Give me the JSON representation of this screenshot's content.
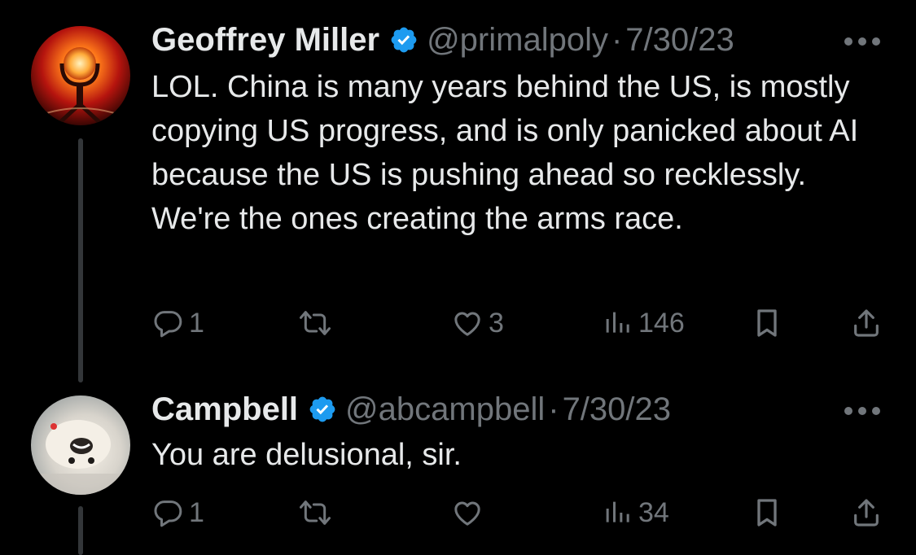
{
  "tweets": [
    {
      "author": {
        "name": "Geoffrey Miller",
        "handle": "@primalpoly",
        "verified": true
      },
      "date": "7/30/23",
      "separator": "·",
      "text": "LOL. China is many years behind the US, is mostly copying US progress, and is only panicked about AI because the US is pushing ahead so recklessly. We're the ones creating the arms race.",
      "stats": {
        "replies": "1",
        "retweets": "",
        "likes": "3",
        "views": "146"
      },
      "icons": {
        "reply": "reply-icon",
        "retweet": "retweet-icon",
        "like": "heart-icon",
        "views": "views-icon",
        "bookmark": "bookmark-icon",
        "share": "share-icon",
        "more": "more-icon"
      }
    },
    {
      "author": {
        "name": "Campbell",
        "handle": "@abcampbell",
        "verified": true
      },
      "date": "7/30/23",
      "separator": "·",
      "text": "You are delusional, sir.",
      "stats": {
        "replies": "1",
        "retweets": "",
        "likes": "",
        "views": "34"
      },
      "icons": {
        "reply": "reply-icon",
        "retweet": "retweet-icon",
        "like": "heart-icon",
        "views": "views-icon",
        "bookmark": "bookmark-icon",
        "share": "share-icon",
        "more": "more-icon"
      }
    }
  ],
  "colors": {
    "background": "#000000",
    "text": "#e7e9ea",
    "muted": "#71767b",
    "verified": "#1d9bf0",
    "thread_line": "#333639"
  }
}
